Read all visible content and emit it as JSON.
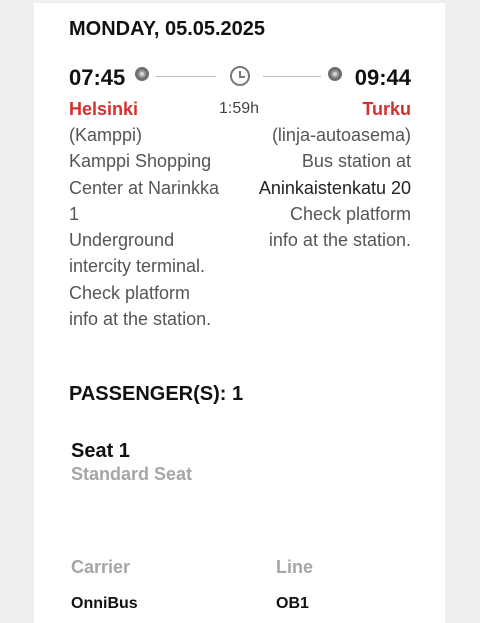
{
  "trip": {
    "date": "MONDAY, 05.05.2025",
    "departure_time": "07:45",
    "arrival_time": "09:44",
    "duration": "1:59h",
    "departure_city": "Helsinki",
    "arrival_city": "Turku",
    "departure_desc": [
      "(Kamppi)",
      "Kamppi Shopping",
      "Center at Narinkka",
      "1",
      "Underground",
      "intercity terminal.",
      "Check platform",
      "info at the station."
    ],
    "arrival_desc": [
      "(linja-autoasema)",
      "Bus station at",
      "Aninkaistenkatu 20",
      "Check platform",
      "info at the station."
    ]
  },
  "passengers": {
    "heading": "PASSENGER(S): 1",
    "seat_title": "Seat 1",
    "seat_type": "Standard Seat"
  },
  "details": {
    "carrier_label": "Carrier",
    "carrier_value": "OnniBus",
    "line_label": "Line",
    "line_value": "OB1"
  },
  "colors": {
    "city": "#d33030",
    "muted": "#a6a6a6"
  },
  "icons": {
    "stop": "stop-dot-icon",
    "duration": "clock-icon"
  }
}
